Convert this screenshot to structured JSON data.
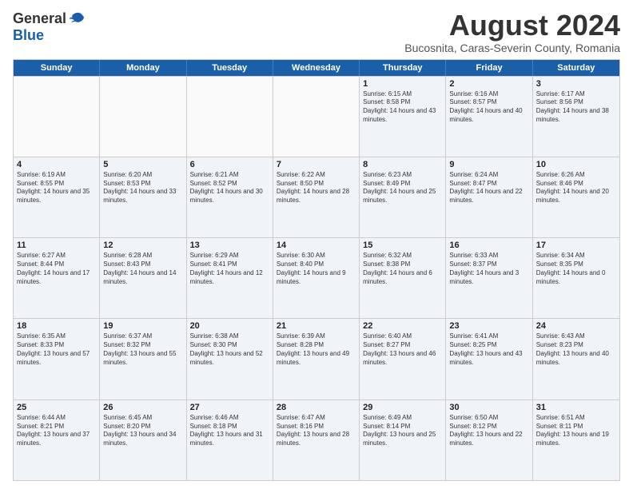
{
  "header": {
    "logo_general": "General",
    "logo_blue": "Blue",
    "month_title": "August 2024",
    "location": "Bucosnita, Caras-Severin County, Romania"
  },
  "days": [
    "Sunday",
    "Monday",
    "Tuesday",
    "Wednesday",
    "Thursday",
    "Friday",
    "Saturday"
  ],
  "rows": [
    [
      {
        "day": "",
        "text": "",
        "empty": true
      },
      {
        "day": "",
        "text": "",
        "empty": true
      },
      {
        "day": "",
        "text": "",
        "empty": true
      },
      {
        "day": "",
        "text": "",
        "empty": true
      },
      {
        "day": "1",
        "text": "Sunrise: 6:15 AM\nSunset: 8:58 PM\nDaylight: 14 hours and 43 minutes."
      },
      {
        "day": "2",
        "text": "Sunrise: 6:16 AM\nSunset: 8:57 PM\nDaylight: 14 hours and 40 minutes."
      },
      {
        "day": "3",
        "text": "Sunrise: 6:17 AM\nSunset: 8:56 PM\nDaylight: 14 hours and 38 minutes."
      }
    ],
    [
      {
        "day": "4",
        "text": "Sunrise: 6:19 AM\nSunset: 8:55 PM\nDaylight: 14 hours and 35 minutes."
      },
      {
        "day": "5",
        "text": "Sunrise: 6:20 AM\nSunset: 8:53 PM\nDaylight: 14 hours and 33 minutes."
      },
      {
        "day": "6",
        "text": "Sunrise: 6:21 AM\nSunset: 8:52 PM\nDaylight: 14 hours and 30 minutes."
      },
      {
        "day": "7",
        "text": "Sunrise: 6:22 AM\nSunset: 8:50 PM\nDaylight: 14 hours and 28 minutes."
      },
      {
        "day": "8",
        "text": "Sunrise: 6:23 AM\nSunset: 8:49 PM\nDaylight: 14 hours and 25 minutes."
      },
      {
        "day": "9",
        "text": "Sunrise: 6:24 AM\nSunset: 8:47 PM\nDaylight: 14 hours and 22 minutes."
      },
      {
        "day": "10",
        "text": "Sunrise: 6:26 AM\nSunset: 8:46 PM\nDaylight: 14 hours and 20 minutes."
      }
    ],
    [
      {
        "day": "11",
        "text": "Sunrise: 6:27 AM\nSunset: 8:44 PM\nDaylight: 14 hours and 17 minutes."
      },
      {
        "day": "12",
        "text": "Sunrise: 6:28 AM\nSunset: 8:43 PM\nDaylight: 14 hours and 14 minutes."
      },
      {
        "day": "13",
        "text": "Sunrise: 6:29 AM\nSunset: 8:41 PM\nDaylight: 14 hours and 12 minutes."
      },
      {
        "day": "14",
        "text": "Sunrise: 6:30 AM\nSunset: 8:40 PM\nDaylight: 14 hours and 9 minutes."
      },
      {
        "day": "15",
        "text": "Sunrise: 6:32 AM\nSunset: 8:38 PM\nDaylight: 14 hours and 6 minutes."
      },
      {
        "day": "16",
        "text": "Sunrise: 6:33 AM\nSunset: 8:37 PM\nDaylight: 14 hours and 3 minutes."
      },
      {
        "day": "17",
        "text": "Sunrise: 6:34 AM\nSunset: 8:35 PM\nDaylight: 14 hours and 0 minutes."
      }
    ],
    [
      {
        "day": "18",
        "text": "Sunrise: 6:35 AM\nSunset: 8:33 PM\nDaylight: 13 hours and 57 minutes."
      },
      {
        "day": "19",
        "text": "Sunrise: 6:37 AM\nSunset: 8:32 PM\nDaylight: 13 hours and 55 minutes."
      },
      {
        "day": "20",
        "text": "Sunrise: 6:38 AM\nSunset: 8:30 PM\nDaylight: 13 hours and 52 minutes."
      },
      {
        "day": "21",
        "text": "Sunrise: 6:39 AM\nSunset: 8:28 PM\nDaylight: 13 hours and 49 minutes."
      },
      {
        "day": "22",
        "text": "Sunrise: 6:40 AM\nSunset: 8:27 PM\nDaylight: 13 hours and 46 minutes."
      },
      {
        "day": "23",
        "text": "Sunrise: 6:41 AM\nSunset: 8:25 PM\nDaylight: 13 hours and 43 minutes."
      },
      {
        "day": "24",
        "text": "Sunrise: 6:43 AM\nSunset: 8:23 PM\nDaylight: 13 hours and 40 minutes."
      }
    ],
    [
      {
        "day": "25",
        "text": "Sunrise: 6:44 AM\nSunset: 8:21 PM\nDaylight: 13 hours and 37 minutes."
      },
      {
        "day": "26",
        "text": "Sunrise: 6:45 AM\nSunset: 8:20 PM\nDaylight: 13 hours and 34 minutes."
      },
      {
        "day": "27",
        "text": "Sunrise: 6:46 AM\nSunset: 8:18 PM\nDaylight: 13 hours and 31 minutes."
      },
      {
        "day": "28",
        "text": "Sunrise: 6:47 AM\nSunset: 8:16 PM\nDaylight: 13 hours and 28 minutes."
      },
      {
        "day": "29",
        "text": "Sunrise: 6:49 AM\nSunset: 8:14 PM\nDaylight: 13 hours and 25 minutes."
      },
      {
        "day": "30",
        "text": "Sunrise: 6:50 AM\nSunset: 8:12 PM\nDaylight: 13 hours and 22 minutes."
      },
      {
        "day": "31",
        "text": "Sunrise: 6:51 AM\nSunset: 8:11 PM\nDaylight: 13 hours and 19 minutes."
      }
    ]
  ]
}
